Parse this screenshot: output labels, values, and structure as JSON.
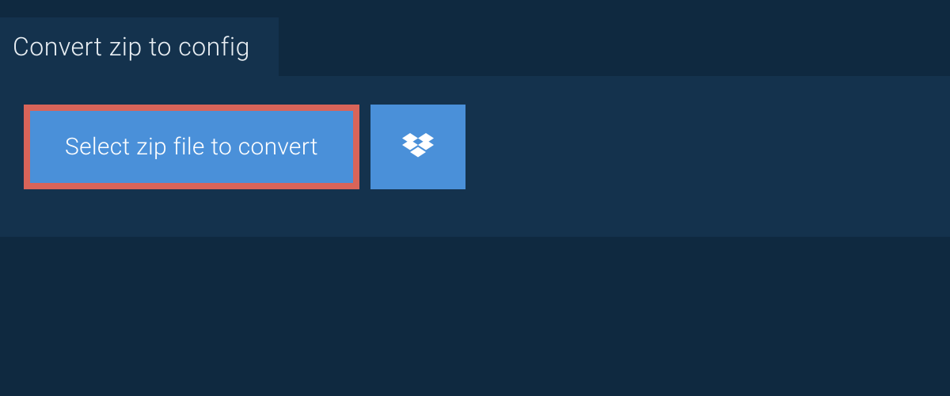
{
  "tab": {
    "title": "Convert zip to config"
  },
  "actions": {
    "select_file_label": "Select zip file to convert"
  },
  "colors": {
    "background": "#0f2940",
    "panel": "#14324d",
    "button_bg": "#4a90d9",
    "highlight_border": "#d96459",
    "text_light": "#ffffff",
    "text_tab": "#e8eef3"
  }
}
